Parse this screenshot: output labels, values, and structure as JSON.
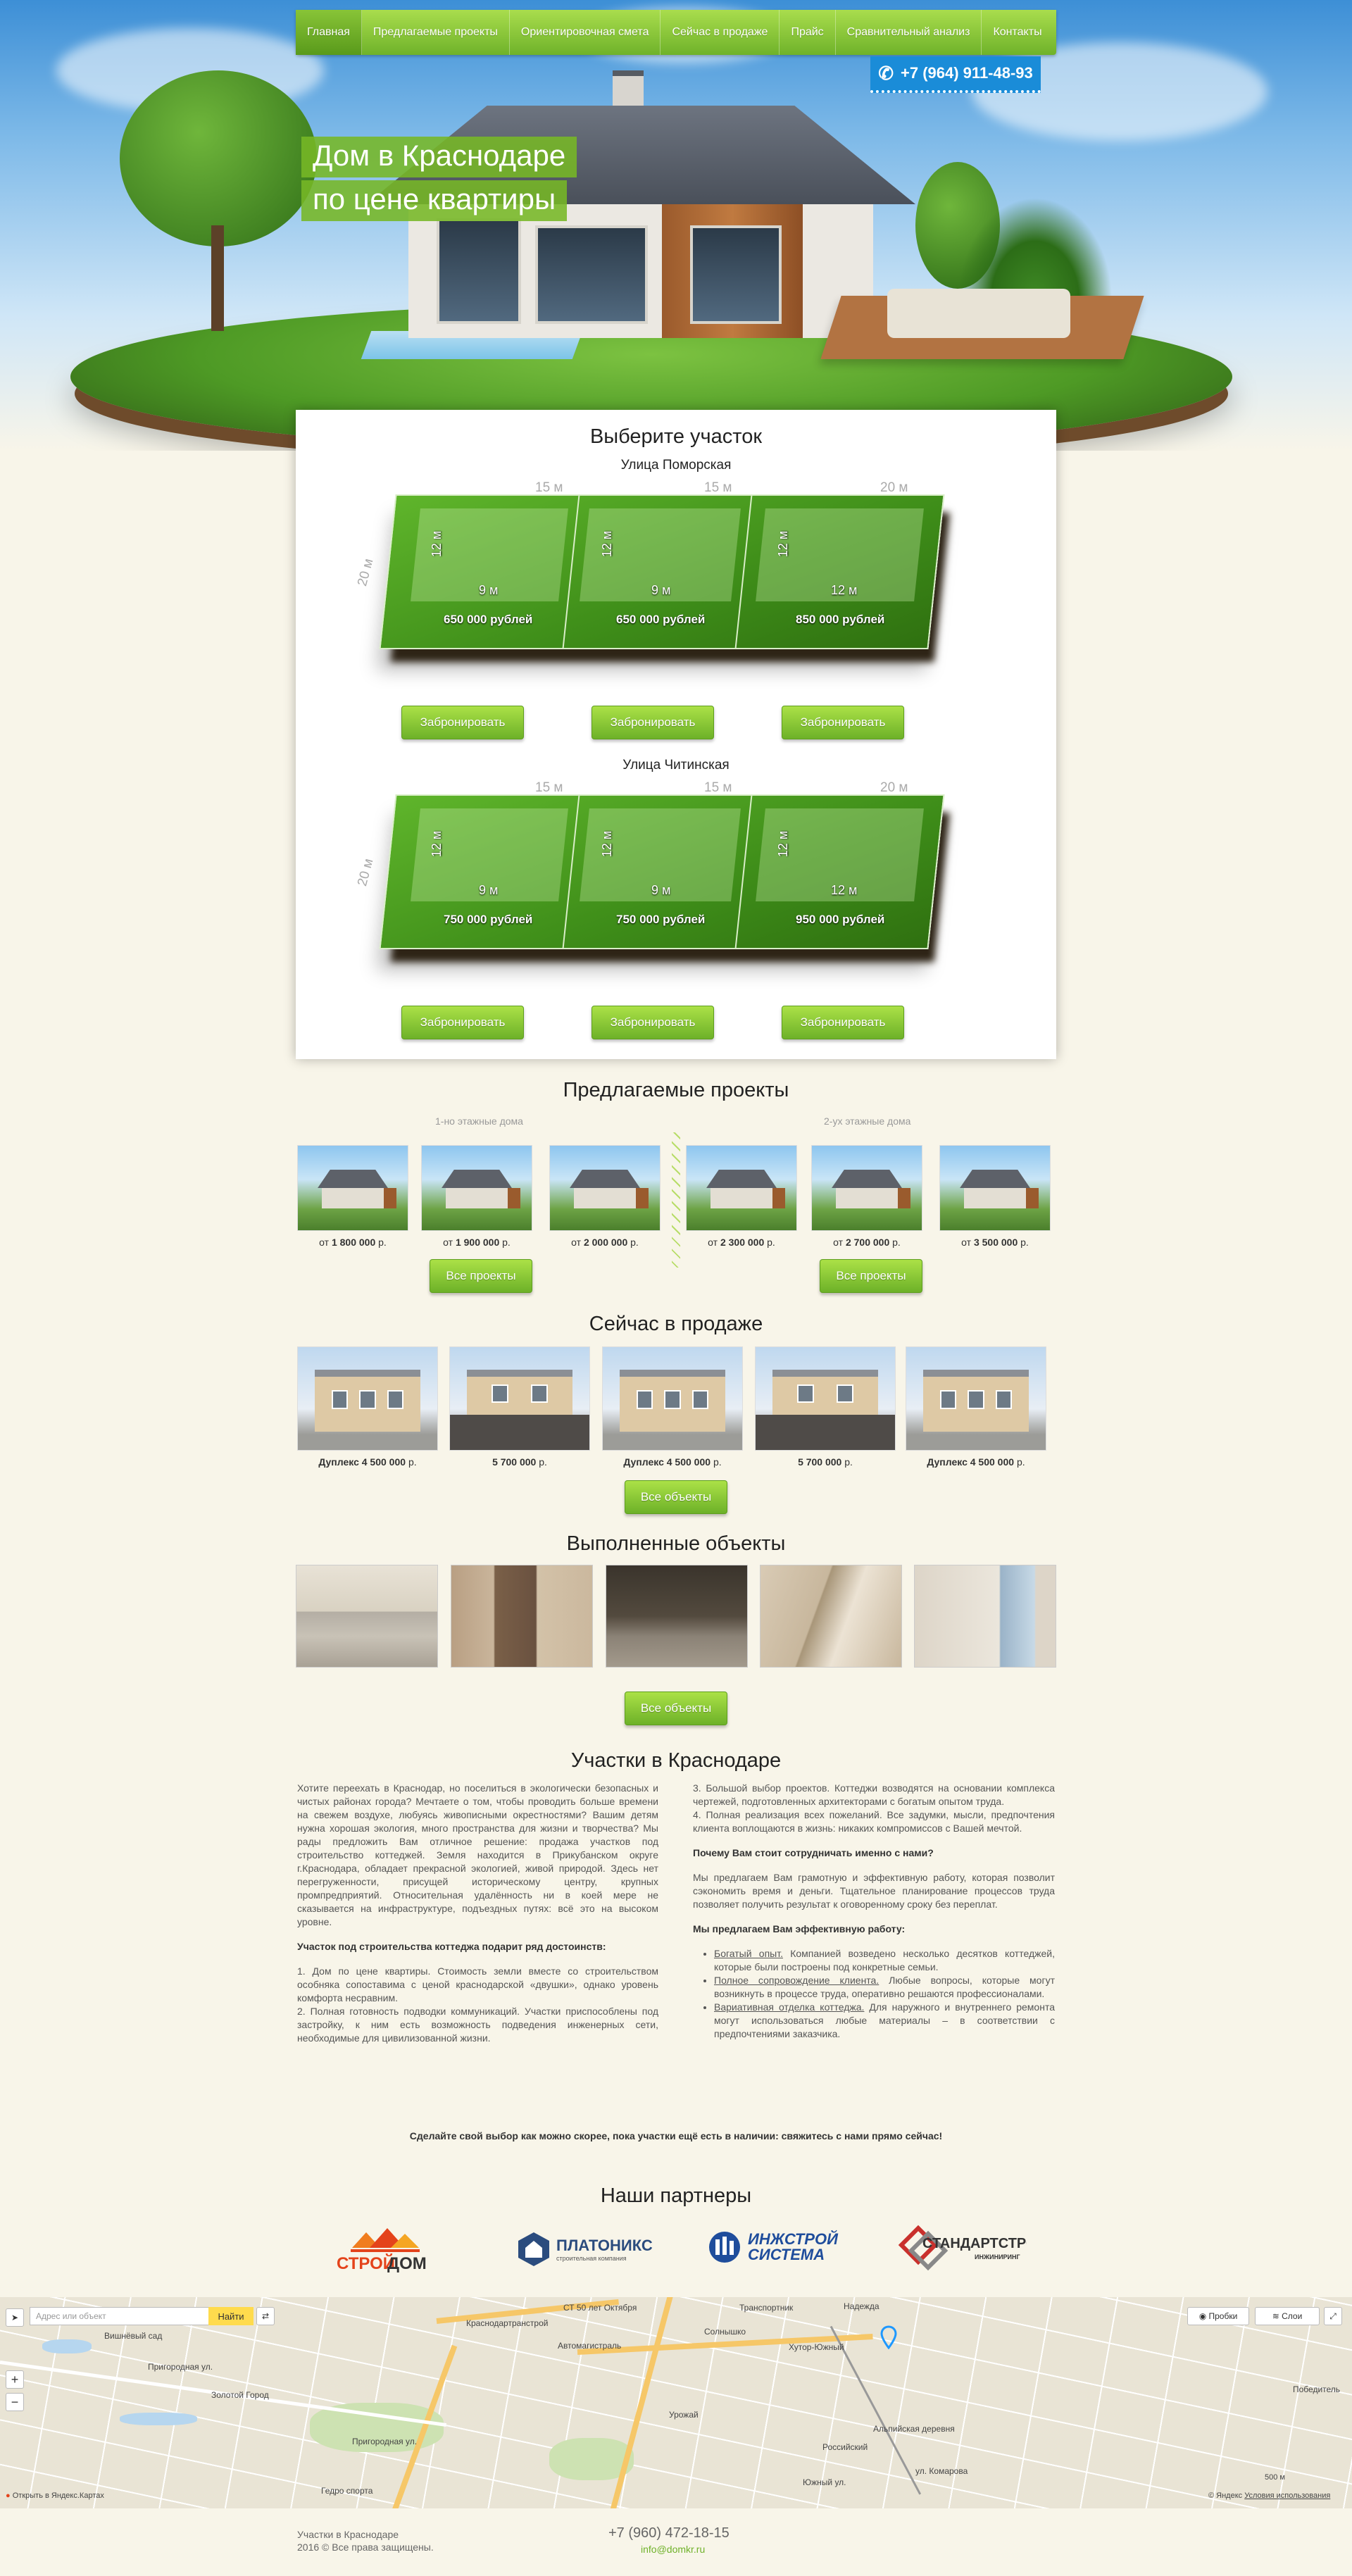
{
  "nav": {
    "items": [
      "Главная",
      "Предлагаемые проекты",
      "Ориентировочная смета",
      "Сейчас в продаже",
      "Прайс",
      "Сравнительный анализ",
      "Контакты"
    ]
  },
  "phone": "+7 (964) 911-48-93",
  "hero": {
    "line1": "Дом в Краснодаре",
    "line2": "по цене квартиры"
  },
  "plots": {
    "title": "Выберите участок",
    "book_label": "Забронировать",
    "streets": [
      {
        "name": "Улица Поморская",
        "widths": [
          "15 м",
          "15 м",
          "20 м"
        ],
        "depth": "20 м",
        "house_depth": "12 м",
        "house_widths": [
          "9 м",
          "9 м",
          "12 м"
        ],
        "prices": [
          "650 000 рублей",
          "650 000 рублей",
          "850 000 рублей"
        ]
      },
      {
        "name": "Улица Читинская",
        "widths": [
          "15 м",
          "15 м",
          "20 м"
        ],
        "depth": "20 м",
        "house_depth": "12 м",
        "house_widths": [
          "9 м",
          "9 м",
          "12 м"
        ],
        "prices": [
          "750 000 рублей",
          "750 000 рублей",
          "950 000 рублей"
        ]
      }
    ]
  },
  "projects": {
    "title": "Предлагаемые проекты",
    "one_floor": "1-но этажные дома",
    "two_floor": "2-ух этажные дома",
    "prefix": "от",
    "suffix": "р.",
    "prices": [
      "1 800 000",
      "1 900 000",
      "2 000 000",
      "2 300 000",
      "2 700 000",
      "3 500 000"
    ],
    "all_label": "Все проекты"
  },
  "sale": {
    "title": "Сейчас в продаже",
    "items": [
      {
        "name": "Дуплекс",
        "price": "4 500 000",
        "unit": "р."
      },
      {
        "name": "",
        "price": "5 700 000",
        "unit": "р."
      },
      {
        "name": "Дуплекс",
        "price": "4 500 000",
        "unit": "р."
      },
      {
        "name": "",
        "price": "5 700 000",
        "unit": "р."
      },
      {
        "name": "Дуплекс",
        "price": "4 500 000",
        "unit": "р."
      }
    ],
    "all_label": "Все объекты"
  },
  "done": {
    "title": "Выполненные объекты",
    "all_label": "Все объекты"
  },
  "about": {
    "title": "Участки в Краснодаре",
    "p1": "Хотите переехать в Краснодар, но поселиться в экологически безопасных и чистых районах города? Мечтаете о том, чтобы проводить больше времени на свежем воздухе, любуясь живописными окрестностями? Вашим детям нужна хорошая экология, много пространства для жизни и творчества? Мы рады предложить Вам отличное решение: продажа участков под строительство коттеджей. Земля находится в Прикубанском округе г.Краснодара, обладает прекрасной экологией, живой природой. Здесь нет перегруженности, присущей историческому центру, крупных промпредприятий. Относительная удалённость ни в коей мере не сказывается на инфраструктуре, подъездных путях: всё это на высоком уровне.",
    "h1": "Участок под строительства коттеджа подарит ряд достоинств:",
    "l1": "1. Дом по цене квартиры. Стоимость земли вместе со строительством особняка сопоставима с ценой краснодарской «двушки», однако уровень комфорта несравним.",
    "l2": "2. Полная готовность подводки коммуникаций. Участки приспособлены под застройку, к ним есть возможность подведения инженерных сети, необходимые для цивилизованной жизни.",
    "l3": "3. Большой выбор проектов. Коттеджи возводятся на основании комплекса чертежей, подготовленных архитекторами с богатым опытом труда.",
    "l4": "4. Полная реализация всех пожеланий. Все задумки, мысли, предпочтения клиента воплощаются в жизнь: никаких компромиссов с Вашей мечтой.",
    "h2": "Почему Вам стоит сотрудничать именно с нами?",
    "p2": "Мы предлагаем Вам грамотную и эффективную работу, которая позволит сэкономить время и деньги. Тщательное планирование процессов труда позволяет получить результат к оговоренному сроку без переплат.",
    "h3": "Мы предлагаем Вам эффективную работу:",
    "b1u": "Богатый опыт.",
    "b1": " Компанией возведено несколько десятков коттеджей, которые были построены под конкретные семьи.",
    "b2u": "Полное сопровождение клиента.",
    "b2": " Любые вопросы, которые могут возникнуть в процессе труда, оперативно решаются профессионалами.",
    "b3u": "Вариативная отделка коттеджа.",
    "b3": " Для наружного и внутреннего ремонта могут использоваться любые материалы – в соответствии с предпочтениями заказчика.",
    "cta": "Сделайте свой выбор как можно скорее, пока участки ещё есть в наличии: свяжитесь с нами прямо сейчас!"
  },
  "partners": {
    "title": "Наши партнеры",
    "items": [
      {
        "name1": "СТРОЙ",
        "name2": "ДОМ"
      },
      {
        "name": "ПЛАТОНИКС",
        "sub": "строительная компания"
      },
      {
        "name1": "ИНЖСТРОЙ",
        "name2": "СИСТЕМА"
      },
      {
        "name": "СТАНДАРТСТРОЙ",
        "sub": "ИНЖИНИРИНГ"
      }
    ]
  },
  "map": {
    "search_placeholder": "Адрес или объект",
    "find": "Найти",
    "traffic": "Пробки",
    "layers": "Слои",
    "open": "Открыть в Яндекс.Картах",
    "copyright": "© Яндекс",
    "terms": "Условия использования",
    "scale": "500 м",
    "labels": [
      "Краснодартранстрой",
      "СТ 50 лет Октября",
      "Транспортник",
      "Надежда",
      "Вишнёвый сад",
      "Автомагистраль",
      "Солнышко",
      "Хутор-Южный",
      "Победитель",
      "Пригородная ул.",
      "Золотой Город",
      "Урожай",
      "Альпийская деревня",
      "Российский",
      "Пригородная ул.",
      "ул. Комарова",
      "Южный ул.",
      "Гедро спорта"
    ]
  },
  "footer": {
    "line1": "Участки в Краснодаре",
    "line2": "2016 © Все права защищены.",
    "phone": "+7 (960) 472-18-15",
    "email": "info@domkr.ru"
  },
  "colors": {
    "accent": "#6fb22a",
    "phone_bg": "#1a8cd8",
    "page_bg": "#f8f5e9"
  }
}
